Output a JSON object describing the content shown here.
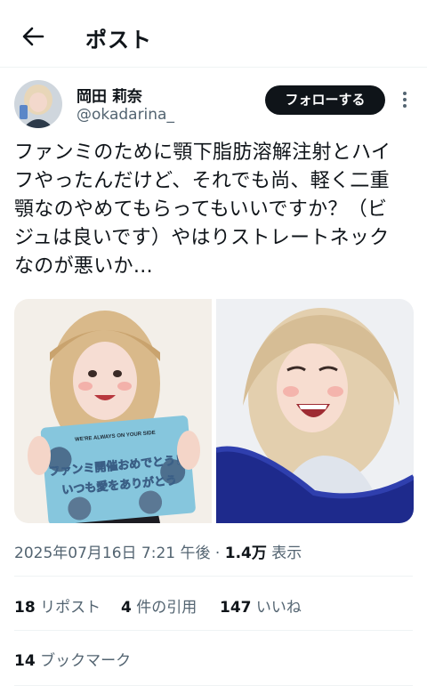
{
  "header": {
    "title": "ポスト",
    "back_icon": "arrow-left-icon"
  },
  "author": {
    "display_name": "岡田 莉奈",
    "handle": "@okadarina_",
    "follow_label": "フォローする",
    "more_icon": "more-vertical-icon"
  },
  "tweet": {
    "text": "ファンミのために顎下脂肪溶解注射とハイ\nフやったんだけど、それでも尚、軽く二重\n顎なのやめてもらってもいいですか？（ビ\nジュは良いです）やはりストレートネック\nなのが悪いか…",
    "images": [
      {
        "sign_header": "WE'RE ALWAYS ON YOUR SIDE",
        "sign_line1": "ファンミ開催おめでとう！",
        "sign_line2": "いつも愛をありがとう"
      },
      {}
    ]
  },
  "meta": {
    "datetime": "2025年07月16日 7:21 午後",
    "separator": "·",
    "views_count": "1.4万",
    "views_label": "表示"
  },
  "stats": {
    "reposts_count": "18",
    "reposts_label": "リポスト",
    "quotes_count": "4",
    "quotes_label": "件の引用",
    "likes_count": "147",
    "likes_label": "いいね",
    "bookmarks_count": "14",
    "bookmarks_label": "ブックマーク"
  },
  "colors": {
    "text": "#0f1419",
    "secondary": "#536471",
    "divider": "#eff3f4",
    "follow_bg": "#0f1419"
  }
}
